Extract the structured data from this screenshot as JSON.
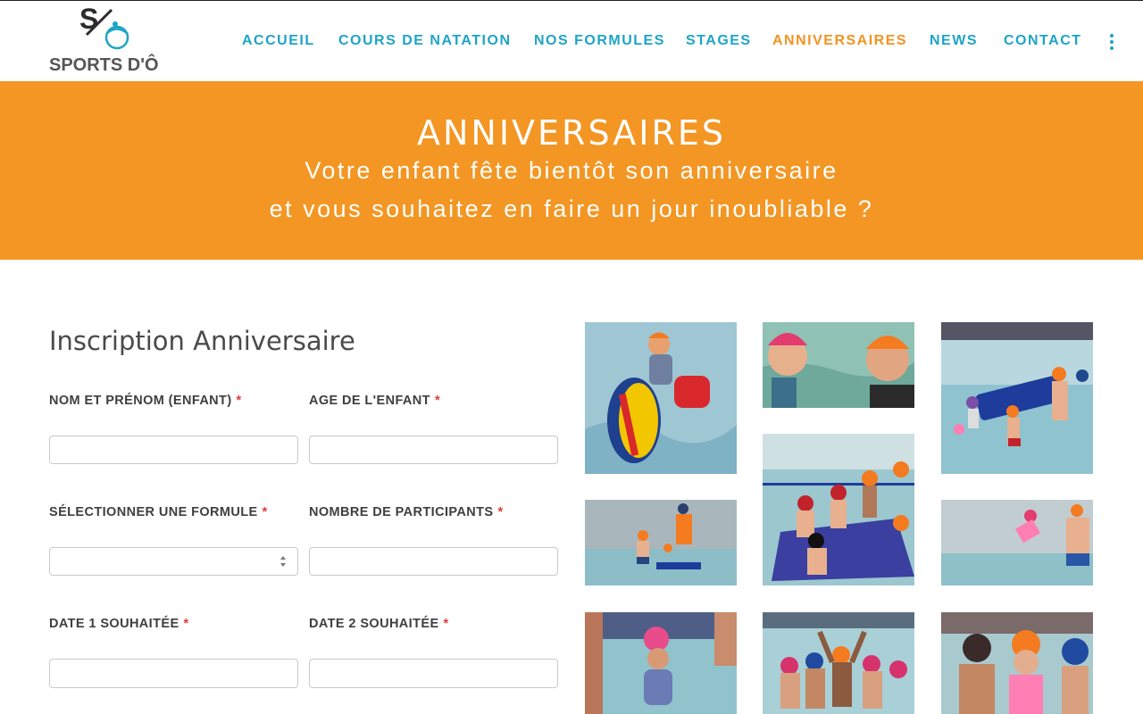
{
  "header": {
    "logo_text": "SPORTS D'Ô",
    "nav": [
      {
        "label": "ACCUEIL"
      },
      {
        "label": "COURS DE NATATION"
      },
      {
        "label": "NOS FORMULES"
      },
      {
        "label": "STAGES"
      },
      {
        "label": "ANNIVERSAIRES",
        "active": true
      },
      {
        "label": "NEWS"
      },
      {
        "label": "CONTACT"
      }
    ],
    "menu_icon": "vertical-dots-icon"
  },
  "hero": {
    "title": "ANNIVERSAIRES",
    "subtitle_line1": "Votre enfant fête bientôt son anniversaire",
    "subtitle_line2": "et vous souhaitez en faire un jour inoubliable ?"
  },
  "form": {
    "title": "Inscription Anniversaire",
    "required_marker": "*",
    "fields": [
      {
        "label": "NOM ET PRÉNOM (ENFANT)",
        "value": ""
      },
      {
        "label": "AGE DE L'ENFANT",
        "value": ""
      },
      {
        "label": "SÉLECTIONNER UNE FORMULE",
        "value": ""
      },
      {
        "label": "NOMBRE DE PARTICIPANTS",
        "value": ""
      },
      {
        "label": "DATE 1 SOUHAITÉE",
        "value": ""
      },
      {
        "label": "DATE 2 SOUHAITÉE",
        "value": ""
      }
    ]
  },
  "colors": {
    "accent_orange": "#f39623",
    "nav_blue": "#1ea4c6",
    "required_red": "#e53935"
  }
}
